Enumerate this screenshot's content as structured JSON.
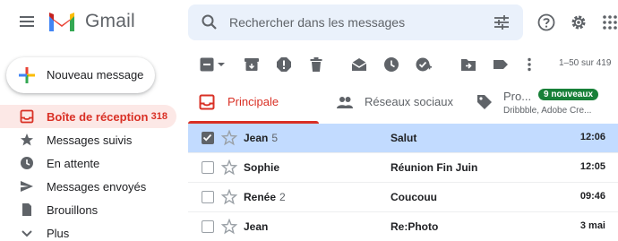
{
  "header": {
    "app_name": "Gmail",
    "search_placeholder": "Rechercher dans les messages"
  },
  "compose": {
    "label": "Nouveau message"
  },
  "sidebar": {
    "items": [
      {
        "label": "Boîte de réception",
        "count": "318",
        "icon": "inbox-icon"
      },
      {
        "label": "Messages suivis",
        "icon": "star-icon"
      },
      {
        "label": "En attente",
        "icon": "clock-icon"
      },
      {
        "label": "Messages envoyés",
        "icon": "send-icon"
      },
      {
        "label": "Brouillons",
        "icon": "draft-icon"
      },
      {
        "label": "Plus",
        "icon": "chevron-down-icon"
      }
    ]
  },
  "toolbar": {
    "pager": "1–50 sur 419"
  },
  "tabs": [
    {
      "label": "Principale",
      "icon": "inbox-icon"
    },
    {
      "label": "Réseaux sociaux",
      "icon": "people-icon"
    },
    {
      "label": "Pro...",
      "icon": "tag-icon",
      "badge": "9 nouveaux",
      "subtitle": "Dribbble, Adobe Cre..."
    }
  ],
  "emails": [
    {
      "sender": "Jean",
      "count": "5",
      "subject": "Salut",
      "time": "12:06",
      "selected": true
    },
    {
      "sender": "Sophie",
      "count": "",
      "subject": "Réunion Fin Juin",
      "time": "12:05",
      "selected": false
    },
    {
      "sender": "Renée",
      "count": "2",
      "subject": "Coucouu",
      "time": "09:46",
      "selected": false
    },
    {
      "sender": "Jean",
      "count": "",
      "subject": "Re:Photo",
      "time": "3 mai",
      "selected": false
    }
  ],
  "colors": {
    "accent_red": "#d93025",
    "selected_row": "#c2dbff",
    "search_bg": "#eaf1fb",
    "badge_green": "#188038"
  }
}
